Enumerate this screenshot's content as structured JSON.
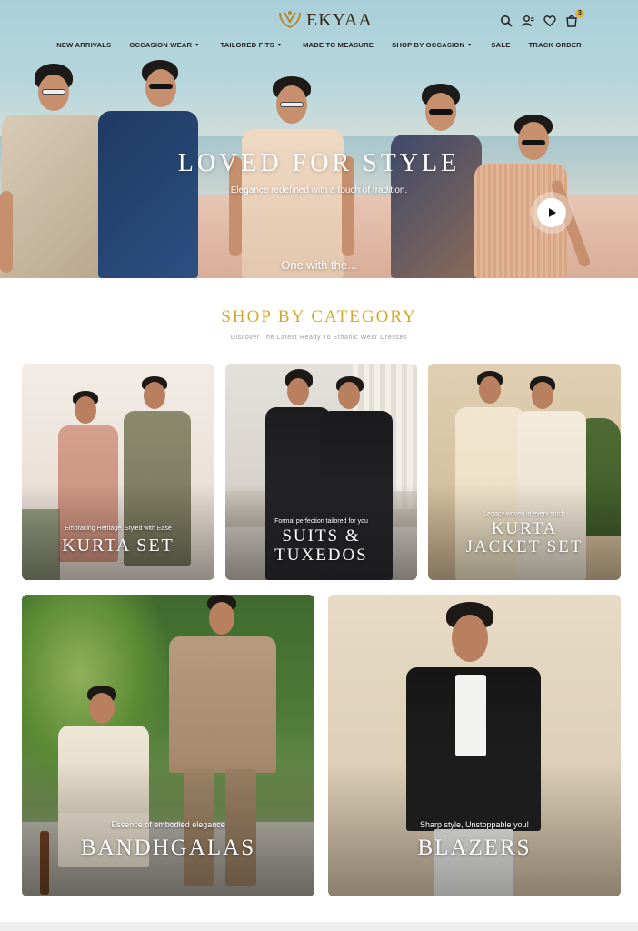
{
  "brand": {
    "name": "EKYAA"
  },
  "nav": {
    "items": [
      {
        "label": "NEW ARRIVALS",
        "dropdown": false
      },
      {
        "label": "OCCASION WEAR",
        "dropdown": true
      },
      {
        "label": "TAILORED FITS",
        "dropdown": true
      },
      {
        "label": "MADE TO MEASURE",
        "dropdown": false
      },
      {
        "label": "SHOP BY OCCASION",
        "dropdown": true
      },
      {
        "label": "SALE",
        "dropdown": false
      },
      {
        "label": "TRACK ORDER",
        "dropdown": false
      }
    ],
    "caret": "▾"
  },
  "header_icons": {
    "search": "search-icon",
    "account": "user-icon",
    "wishlist": "heart-icon",
    "cart": "cart-icon",
    "cart_count": "3"
  },
  "hero": {
    "title": "LOVED FOR STYLE",
    "subtitle": "Elegance redefined with a touch of tradition.",
    "caption": "One with the...",
    "play_icon": "play-icon"
  },
  "category_section": {
    "title": "SHOP BY CATEGORY",
    "subtitle": "Discover The Latest Ready To Ethanic Wear Dresses",
    "cards": [
      {
        "tagline": "Embracing Heritage, Styled with Ease",
        "name_line1": "KURTA SET",
        "name_line2": ""
      },
      {
        "tagline": "Formal perfection tailored for you",
        "name_line1": "SUITS &",
        "name_line2": "TUXEDOS"
      },
      {
        "tagline": "Legacy woven in every stitch",
        "name_line1": "KURTA",
        "name_line2": "JACKET SET"
      },
      {
        "tagline": "Essence of embodied elegance",
        "name_line1": "BANDHGALAS",
        "name_line2": ""
      },
      {
        "tagline": "Sharp style, Unstoppable you!",
        "name_line1": "BLAZERS",
        "name_line2": ""
      }
    ]
  },
  "colors": {
    "accent_gold": "#d4a92b",
    "badge": "#e0b43a",
    "text_dark": "#1f1f1f"
  }
}
